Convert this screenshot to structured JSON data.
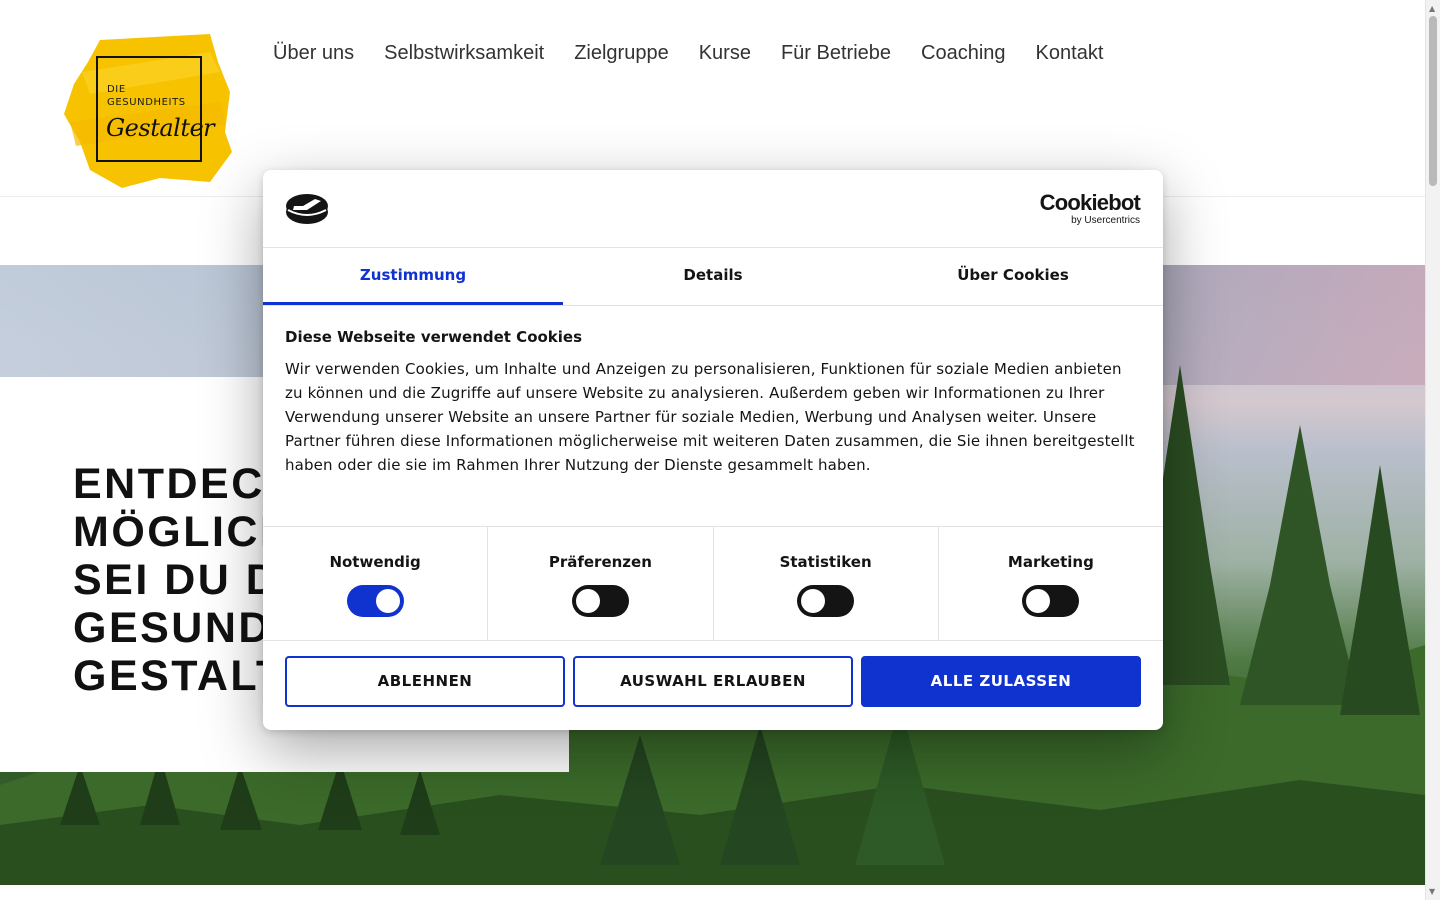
{
  "header": {
    "logo": {
      "line1": "DIE",
      "line2": "GESUNDHEITS",
      "script": "Gestalter"
    },
    "nav": [
      "Über uns",
      "Selbstwirksamkeit",
      "Zielgruppe",
      "Kurse",
      "Für Betriebe",
      "Coaching",
      "Kontakt"
    ]
  },
  "hero": {
    "heading_lines": [
      "ENTDECK",
      "MÖGLICH",
      "SEI DU DI",
      "GESUNDH",
      "GESTALT"
    ]
  },
  "cookie_dialog": {
    "brand": {
      "name": "Cookiebot",
      "sub": "by Usercentrics"
    },
    "tabs": [
      {
        "label": "Zustimmung",
        "active": true
      },
      {
        "label": "Details",
        "active": false
      },
      {
        "label": "Über Cookies",
        "active": false
      }
    ],
    "title": "Diese Webseite verwendet Cookies",
    "text": "Wir verwenden Cookies, um Inhalte und Anzeigen zu personalisieren, Funktionen für soziale Medien anbieten zu können und die Zugriffe auf unsere Website zu analysieren. Außerdem geben wir Informationen zu Ihrer Verwendung unserer Website an unsere Partner für soziale Medien, Werbung und Analysen weiter. Unsere Partner führen diese Informationen möglicherweise mit weiteren Daten zusammen, die Sie ihnen bereitgestellt haben oder die sie im Rahmen Ihrer Nutzung der Dienste gesammelt haben.",
    "toggles": [
      {
        "label": "Notwendig",
        "on": true
      },
      {
        "label": "Präferenzen",
        "on": false
      },
      {
        "label": "Statistiken",
        "on": false
      },
      {
        "label": "Marketing",
        "on": false
      }
    ],
    "buttons": {
      "decline": "ABLEHNEN",
      "allow_selection": "AUSWAHL ERLAUBEN",
      "allow_all": "ALLE ZULASSEN"
    }
  },
  "colors": {
    "accent": "#1032cf",
    "logo_yellow": "#f7c300",
    "text": "#141414"
  }
}
